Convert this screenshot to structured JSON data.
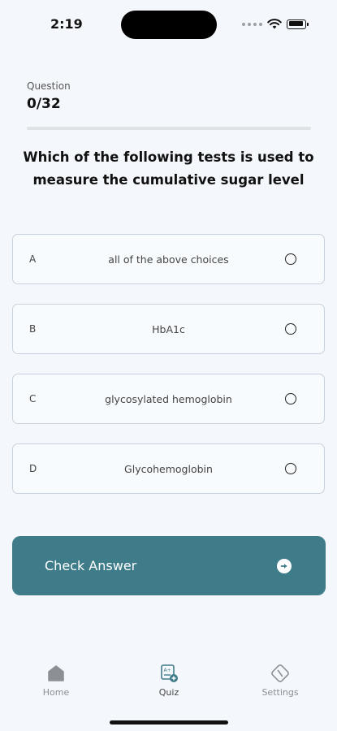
{
  "status_bar": {
    "time": "2:19"
  },
  "quiz": {
    "question_label": "Question",
    "counter": "0/32",
    "progress_fraction": 0,
    "question": "Which of the following tests is used to measure the cumulative sugar level",
    "options": [
      {
        "letter": "A",
        "text": "all of the above choices"
      },
      {
        "letter": "B",
        "text": "HbA1c"
      },
      {
        "letter": "C",
        "text": "glycosylated hemoglobin"
      },
      {
        "letter": "D",
        "text": "Glycohemoglobin"
      }
    ],
    "check_label": "Check Answer"
  },
  "tabs": [
    {
      "label": "Home",
      "icon": "home-icon"
    },
    {
      "label": "Quiz",
      "icon": "quiz-icon"
    },
    {
      "label": "Settings",
      "icon": "settings-icon"
    }
  ],
  "colors": {
    "accent": "#3e7c8a",
    "background": "#f4f8fc",
    "option_border": "#c8d2dc"
  }
}
